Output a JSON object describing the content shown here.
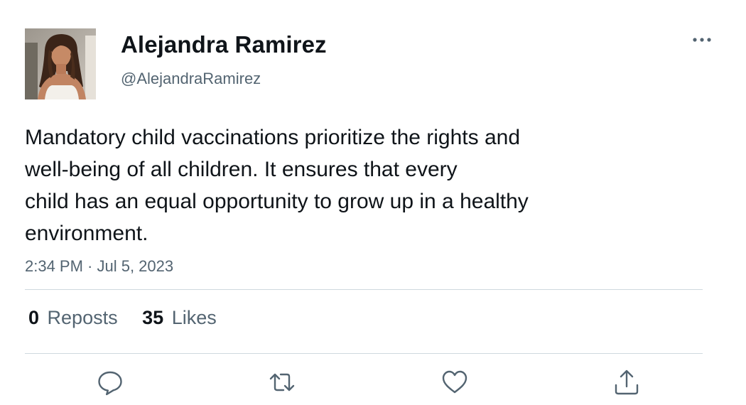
{
  "author": {
    "display_name": "Alejandra Ramirez",
    "handle": "@AlejandraRamirez",
    "avatar_description": "profile photo"
  },
  "tweet": {
    "text_lines": [
      "Mandatory child vaccinations prioritize the rights and",
      "well-being of all children. It ensures that every",
      "child has an equal opportunity to grow up in a healthy",
      "environment."
    ],
    "timestamp": "2:34 PM · Jul 5, 2023"
  },
  "stats": {
    "reposts_count": "0",
    "reposts_label": "Reposts",
    "likes_count": "35",
    "likes_label": "Likes"
  },
  "actions": {
    "reply_icon": "reply-icon",
    "repost_icon": "repost-icon",
    "like_icon": "heart-icon",
    "share_icon": "share-icon",
    "more_icon": "more-icon"
  },
  "colors": {
    "text_primary": "#0f1419",
    "text_secondary": "#536471",
    "divider": "#cfd9de",
    "icon": "#536471"
  }
}
